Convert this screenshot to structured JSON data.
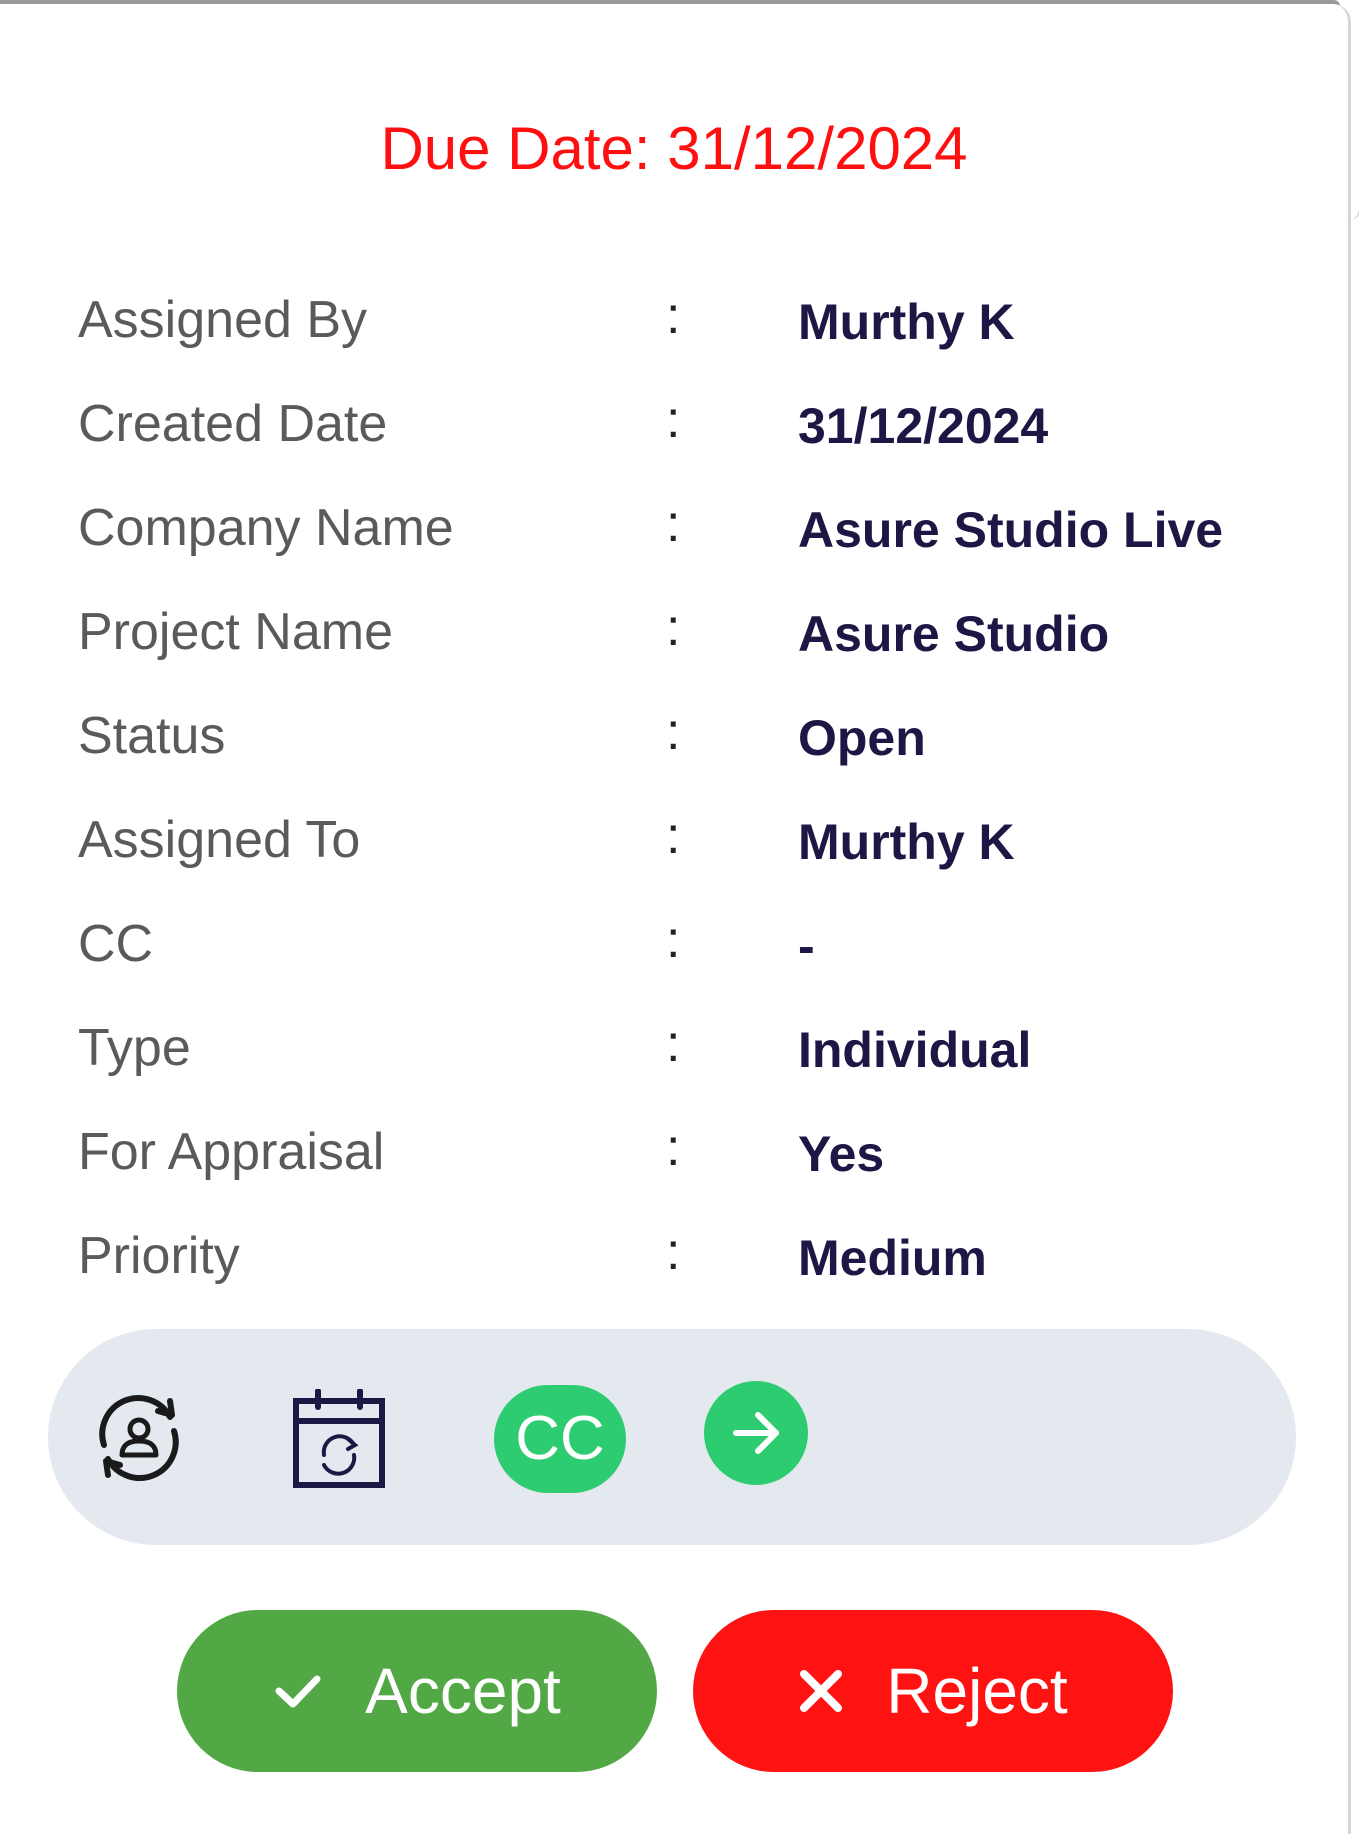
{
  "due_date": "Due Date: 31/12/2024",
  "details": [
    {
      "label": "Assigned By",
      "value": "Murthy K"
    },
    {
      "label": "Created Date",
      "value": "31/12/2024"
    },
    {
      "label": "Company Name",
      "value": "Asure Studio Live"
    },
    {
      "label": "Project Name",
      "value": "Asure Studio"
    },
    {
      "label": "Status",
      "value": "Open"
    },
    {
      "label": "Assigned To",
      "value": "Murthy K"
    },
    {
      "label": "CC",
      "value": "-"
    },
    {
      "label": "Type",
      "value": "Individual"
    },
    {
      "label": "For Appraisal",
      "value": "Yes"
    },
    {
      "label": "Priority",
      "value": "Medium"
    }
  ],
  "separator": ":",
  "actions": {
    "reassign_icon": "user-sync-icon",
    "reschedule_icon": "calendar-sync-icon",
    "cc_label": "CC",
    "forward_icon": "arrow-right-icon"
  },
  "buttons": {
    "accept_label": "Accept",
    "reject_label": "Reject"
  },
  "colors": {
    "due_date": "#ff1010",
    "label": "#5a5a5a",
    "value": "#1c1744",
    "action_bar": "#e4e9ef",
    "green_icon": "#2ecc71",
    "accept": "#51a844",
    "reject": "#ff1212"
  }
}
